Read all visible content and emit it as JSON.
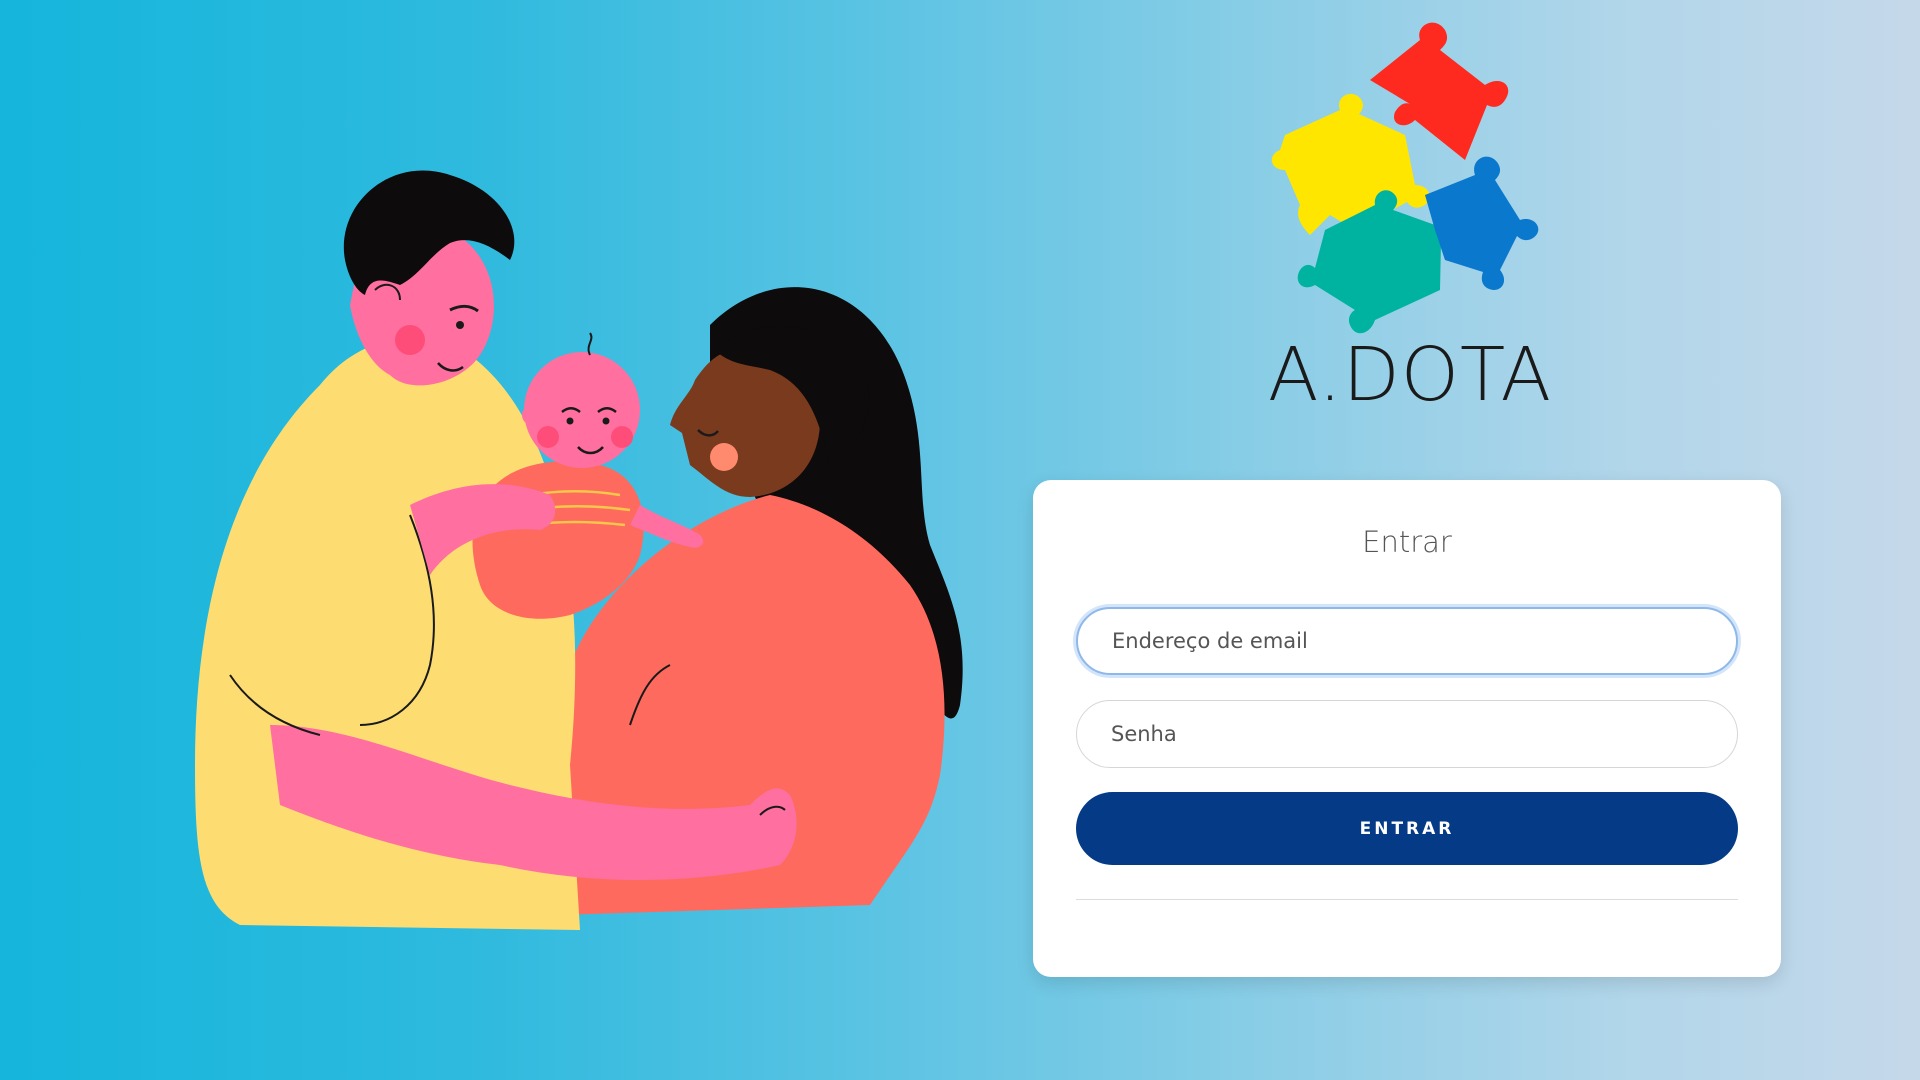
{
  "brand": {
    "name": "A.DOTA",
    "puzzle_colors": {
      "red": "#ff2a1f",
      "yellow": "#ffe600",
      "green": "#00b3a0",
      "blue": "#0a78cc"
    }
  },
  "illustration": {
    "description_icon": "family-illustration"
  },
  "login": {
    "title": "Entrar",
    "email_placeholder": "Endereço de email",
    "email_value": "",
    "password_placeholder": "Senha",
    "password_value": "",
    "submit_label": "ENTRAR"
  },
  "colors": {
    "primary_button": "#053b86",
    "focus_border": "#8fb8ea"
  }
}
